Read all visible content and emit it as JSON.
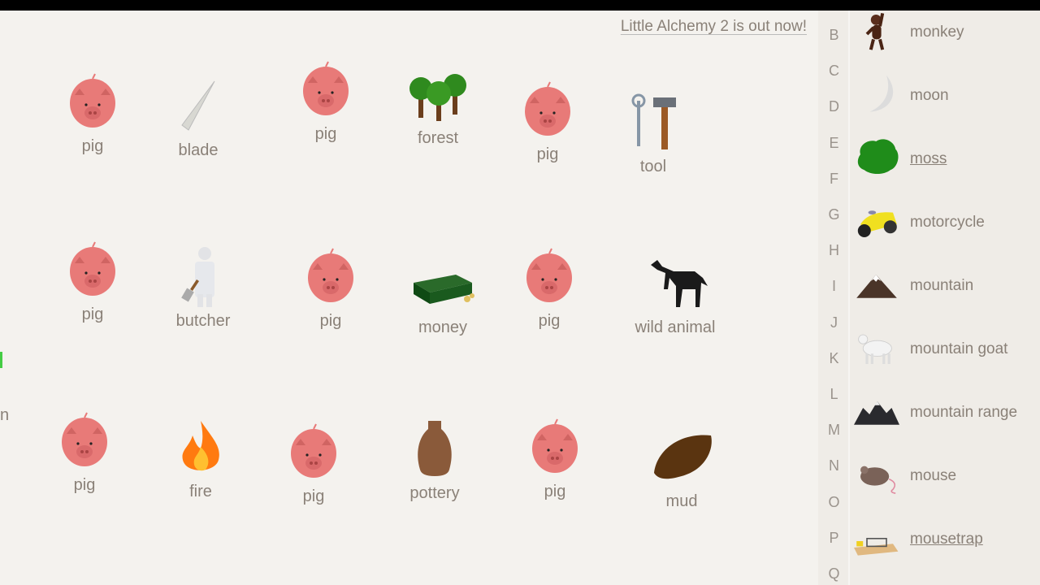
{
  "banner": "Little Alchemy 2 is out now!",
  "workspace": {
    "elements": [
      {
        "label": "pig",
        "icon": "pig"
      },
      {
        "label": "blade",
        "icon": "blade"
      },
      {
        "label": "pig",
        "icon": "pig"
      },
      {
        "label": "forest",
        "icon": "forest"
      },
      {
        "label": "pig",
        "icon": "pig"
      },
      {
        "label": "tool",
        "icon": "tool"
      },
      {
        "label": "pig",
        "icon": "pig"
      },
      {
        "label": "butcher",
        "icon": "butcher"
      },
      {
        "label": "pig",
        "icon": "pig"
      },
      {
        "label": "money",
        "icon": "money"
      },
      {
        "label": "pig",
        "icon": "pig"
      },
      {
        "label": "wild animal",
        "icon": "wild-animal"
      },
      {
        "label": "pig",
        "icon": "pig"
      },
      {
        "label": "fire",
        "icon": "fire"
      },
      {
        "label": "pig",
        "icon": "pig"
      },
      {
        "label": "pottery",
        "icon": "pottery"
      },
      {
        "label": "pig",
        "icon": "pig"
      },
      {
        "label": "mud",
        "icon": "mud"
      }
    ],
    "edge_fragment": "n"
  },
  "sidebar": {
    "letters": [
      "B",
      "C",
      "D",
      "E",
      "F",
      "G",
      "H",
      "I",
      "J",
      "K",
      "L",
      "M",
      "N",
      "O",
      "P",
      "Q"
    ],
    "items": [
      {
        "label": "monkey",
        "icon": "monkey",
        "underlined": false
      },
      {
        "label": "moon",
        "icon": "moon",
        "underlined": false
      },
      {
        "label": "moss",
        "icon": "moss",
        "underlined": true
      },
      {
        "label": "motorcycle",
        "icon": "motorcycle",
        "underlined": false
      },
      {
        "label": "mountain",
        "icon": "mountain",
        "underlined": false
      },
      {
        "label": "mountain goat",
        "icon": "mountain-goat",
        "underlined": false
      },
      {
        "label": "mountain range",
        "icon": "mountain-range",
        "underlined": false
      },
      {
        "label": "mouse",
        "icon": "mouse",
        "underlined": false
      },
      {
        "label": "mousetrap",
        "icon": "mousetrap",
        "underlined": true
      }
    ]
  }
}
